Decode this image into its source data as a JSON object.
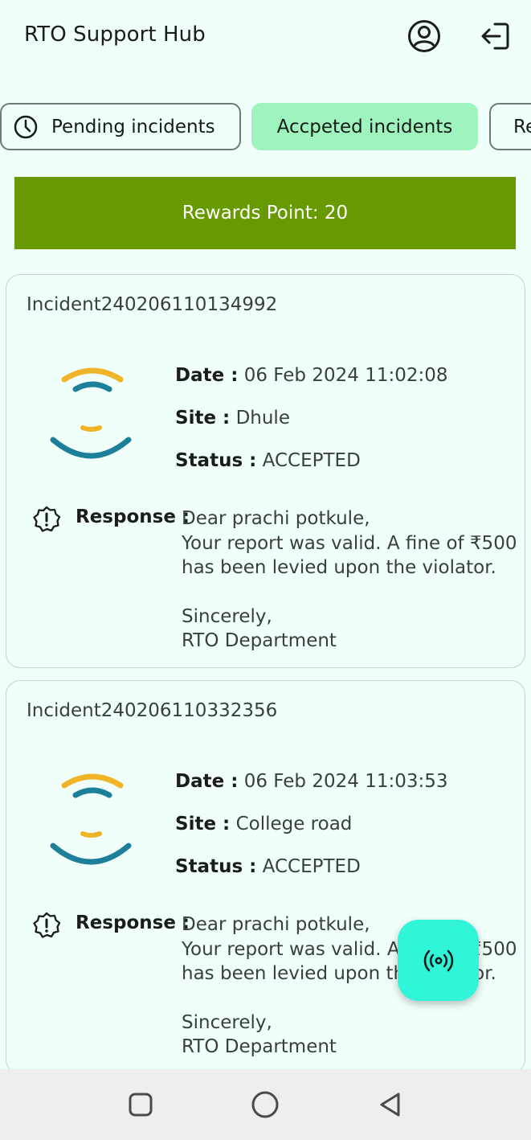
{
  "app": {
    "title": "RTO Support Hub",
    "profile_icon": "account-circle-icon",
    "logout_icon": "logout-icon"
  },
  "tabs": [
    {
      "label": "Pending incidents",
      "icon": "clock-icon",
      "selected": false
    },
    {
      "label": "Accpeted incidents",
      "selected": true
    },
    {
      "label": "Re",
      "selected": false
    }
  ],
  "rewards": {
    "label": "Rewards Point: 20"
  },
  "incidents": [
    {
      "id": "Incident240206110134992",
      "date_key": "Date :",
      "date": "06 Feb 2024 11:02:08",
      "site_key": "Site :",
      "site": "Dhule",
      "status_key": "Status :",
      "status": "ACCEPTED",
      "response_key": "Response :",
      "response_lines": [
        "Dear prachi potkule,",
        "Your report was valid. A fine of ₹500",
        "has been levied upon the violator.",
        "Sincerely,",
        "RTO Department"
      ]
    },
    {
      "id": "Incident240206110332356",
      "date_key": "Date :",
      "date": "06 Feb 2024 11:03:53",
      "site_key": "Site :",
      "site": "College road",
      "status_key": "Status :",
      "status": "ACCEPTED",
      "response_key": "Response :",
      "response_lines": [
        "Dear prachi potkule,",
        "Your report was valid. A fine of ₹500",
        "has been levied upon the violator.",
        "Sincerely,",
        "RTO Department"
      ]
    }
  ],
  "fab": {
    "icon": "broadcast-icon"
  },
  "system_nav": {
    "recents_icon": "square-recents-icon",
    "home_icon": "circle-home-icon",
    "back_icon": "triangle-back-icon"
  },
  "colors": {
    "background": "#f1fffb",
    "accent_tab": "#9ef4bc",
    "rewards_bar": "#679a00",
    "fab": "#30f5d8",
    "logo_yellow": "#f0b429",
    "logo_teal": "#1e7f9a"
  }
}
